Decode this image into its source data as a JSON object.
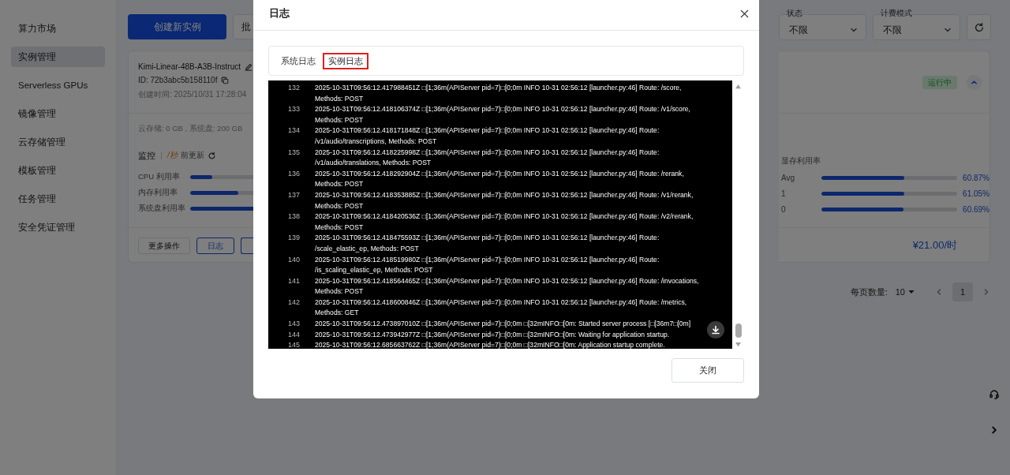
{
  "sidebar": {
    "items": [
      {
        "label": "算力市场",
        "selected": false
      },
      {
        "label": "实例管理",
        "selected": true
      },
      {
        "label": "Serverless GPUs",
        "selected": false
      },
      {
        "label": "镜像管理",
        "selected": false
      },
      {
        "label": "云存储管理",
        "selected": false
      },
      {
        "label": "模板管理",
        "selected": false
      },
      {
        "label": "任务管理",
        "selected": false
      },
      {
        "label": "安全凭证管理",
        "selected": false
      }
    ]
  },
  "toolbar": {
    "create_button": "创建新实例",
    "batch_button": "批",
    "filters": [
      {
        "label": "状态",
        "value": "不限"
      },
      {
        "label": "计费模式",
        "value": "不限"
      }
    ]
  },
  "instance": {
    "name": "Kimi-Linear-48B-A3B-Instruct",
    "id": "ID: 72b3abc5b158110f",
    "created": "创建时间: 2025/10/31 17:28:04",
    "status": {
      "label": "运行中",
      "kind": "running"
    },
    "expanded": true,
    "storage": "云存储: 0 GB , 系统盘: 200 GB",
    "monitor": {
      "title": "监控",
      "refresh_time": "/秒",
      "refresh_label": "前更新"
    },
    "metrics": [
      {
        "label": "CPU 利用率",
        "level": 0.33
      },
      {
        "label": "内存利用率",
        "level": 0.73
      },
      {
        "label": "系统盘利用率",
        "level": 0.96
      }
    ],
    "gpu_memory": {
      "title": "显存利用率",
      "rows": [
        {
          "label": "Avg",
          "level": 0.6087,
          "reading": "60.87%"
        },
        {
          "label": "1",
          "level": 0.6105,
          "reading": "61.05%"
        },
        {
          "label": "0",
          "level": 0.6069,
          "reading": "60.69%"
        }
      ]
    },
    "actions": [
      {
        "label": "更多操作",
        "kind": "default"
      },
      {
        "label": "日志",
        "kind": "outline"
      },
      {
        "kind": "outline"
      }
    ],
    "price": "¥21.00/时"
  },
  "pagination": {
    "page_size_label": "每页数量:",
    "page_size": "10",
    "pages": [
      {
        "label": "1",
        "selected": true
      }
    ]
  },
  "dialog": {
    "title": "日志",
    "tabs": [
      {
        "label": "系统日志",
        "selected": false
      },
      {
        "label": "实例日志",
        "selected": true
      }
    ],
    "log": [
      {
        "number": "132",
        "lines": [
          "2025-10-31T09:56:12.417988451Z □[1;36m(APIServer pid=7)□[0;0m INFO 10-31 02:56:12 [launcher.py:46] Route: /score,",
          "Methods: POST"
        ]
      },
      {
        "number": "133",
        "lines": [
          "2025-10-31T09:56:12.418106374Z □[1;36m(APIServer pid=7)□[0;0m INFO 10-31 02:56:12 [launcher.py:46] Route: /v1/score,",
          "Methods: POST"
        ]
      },
      {
        "number": "134",
        "lines": [
          "2025-10-31T09:56:12.418171848Z □[1;36m(APIServer pid=7)□[0;0m INFO 10-31 02:56:12 [launcher.py:46] Route:",
          "/v1/audio/transcriptions, Methods: POST"
        ]
      },
      {
        "number": "135",
        "lines": [
          "2025-10-31T09:56:12.418225998Z □[1;36m(APIServer pid=7)□[0;0m INFO 10-31 02:56:12 [launcher.py:46] Route:",
          "/v1/audio/translations, Methods: POST"
        ]
      },
      {
        "number": "136",
        "lines": [
          "2025-10-31T09:56:12.418292904Z □[1;36m(APIServer pid=7)□[0;0m INFO 10-31 02:56:12 [launcher.py:46] Route: /rerank,",
          "Methods: POST"
        ]
      },
      {
        "number": "137",
        "lines": [
          "2025-10-31T09:56:12.418353885Z □[1;36m(APIServer pid=7)□[0;0m INFO 10-31 02:56:12 [launcher.py:46] Route: /v1/rerank,",
          "Methods: POST"
        ]
      },
      {
        "number": "138",
        "lines": [
          "2025-10-31T09:56:12.418420536Z □[1;36m(APIServer pid=7)□[0;0m INFO 10-31 02:56:12 [launcher.py:46] Route: /v2/rerank,",
          "Methods: POST"
        ]
      },
      {
        "number": "139",
        "lines": [
          "2025-10-31T09:56:12.418475593Z □[1;36m(APIServer pid=7)□[0;0m INFO 10-31 02:56:12 [launcher.py:46] Route:",
          "/scale_elastic_ep, Methods: POST"
        ]
      },
      {
        "number": "140",
        "lines": [
          "2025-10-31T09:56:12.418519980Z □[1;36m(APIServer pid=7)□[0;0m INFO 10-31 02:56:12 [launcher.py:46] Route:",
          "/is_scaling_elastic_ep, Methods: POST"
        ]
      },
      {
        "number": "141",
        "lines": [
          "2025-10-31T09:56:12.418564465Z □[1;36m(APIServer pid=7)□[0;0m INFO 10-31 02:56:12 [launcher.py:46] Route: /invocations,",
          "Methods: POST"
        ]
      },
      {
        "number": "142",
        "lines": [
          "2025-10-31T09:56:12.418600846Z □[1;36m(APIServer pid=7)□[0;0m INFO 10-31 02:56:12 [launcher.py:46] Route: /metrics,",
          "Methods: GET"
        ]
      },
      {
        "number": "143",
        "lines": [
          "2025-10-31T09:56:12.473897010Z □[1;36m(APIServer pid=7)□[0;0m □[32mINFO□[0m: Started server process [□[36m7□[0m]"
        ]
      },
      {
        "number": "144",
        "lines": [
          "2025-10-31T09:56:12.473942977Z □[1;36m(APIServer pid=7)□[0;0m □[32mINFO□[0m: Waiting for application startup."
        ]
      },
      {
        "number": "145",
        "lines": [
          "2025-10-31T09:56:12.685663762Z □[1;36m(APIServer pid=7)□[0;0m □[32mINFO□[0m: Application startup complete."
        ]
      }
    ],
    "close_button": "关闭"
  }
}
